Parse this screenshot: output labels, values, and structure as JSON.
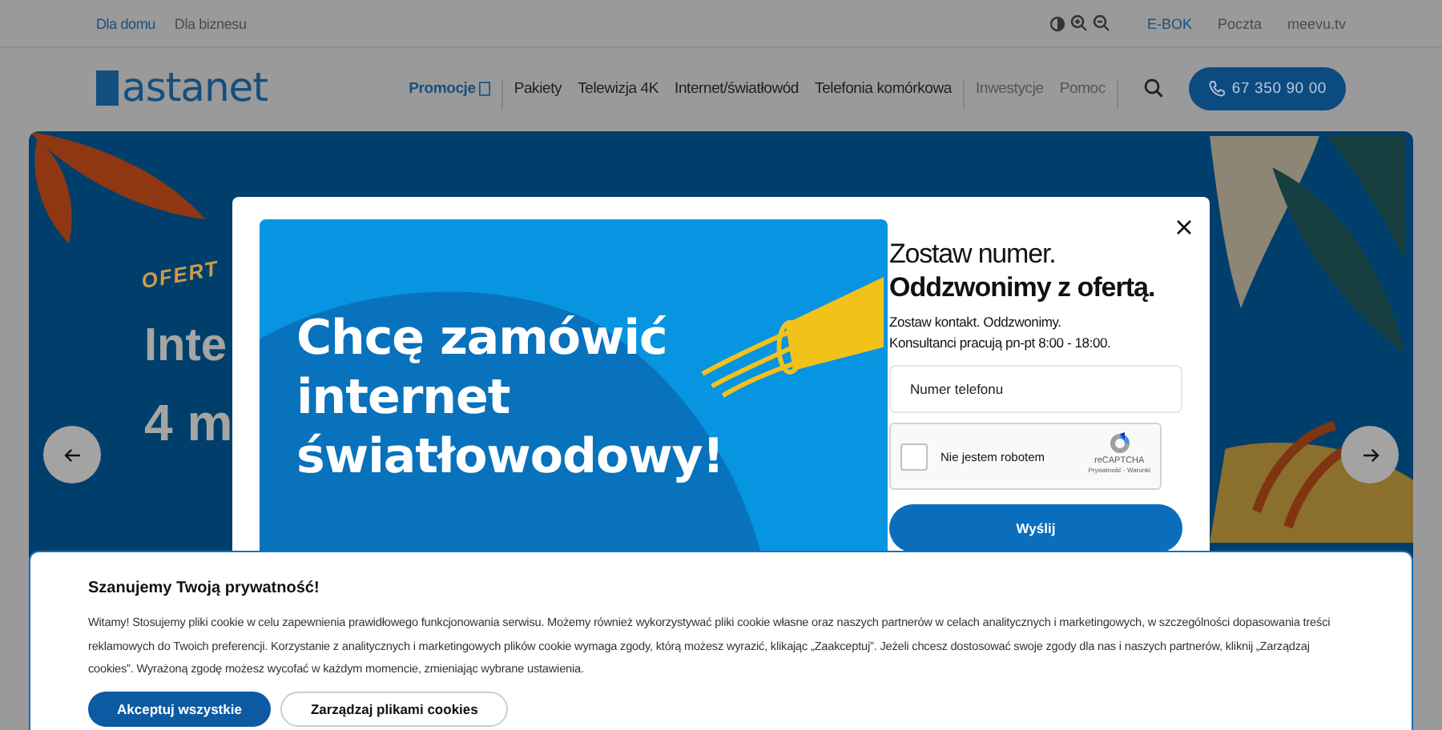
{
  "top_bar": {
    "segments": [
      {
        "label": "Dla domu",
        "selected": true
      },
      {
        "label": "Dla biznesu",
        "selected": false
      }
    ],
    "links": [
      {
        "label": "E-BOK",
        "kind": "accent"
      },
      {
        "label": "Poczta",
        "kind": "plain"
      },
      {
        "label": "meevu.tv",
        "kind": "plain"
      }
    ]
  },
  "header": {
    "logo": "astanet",
    "nav": [
      {
        "label": "Promocje",
        "kind": "promo"
      },
      {
        "label": "Pakiety",
        "kind": "main"
      },
      {
        "label": "Telewizja 4K",
        "kind": "main"
      },
      {
        "label": "Internet/światłowód",
        "kind": "main"
      },
      {
        "label": "Telefonia komórkowa",
        "kind": "main"
      },
      {
        "label": "Inwestycje",
        "kind": "secondary"
      },
      {
        "label": "Pomoc",
        "kind": "secondary"
      }
    ],
    "phone": "67 350 90 00"
  },
  "hero": {
    "tag": "OFERT",
    "title_lines": [
      "Inte",
      "4 m"
    ]
  },
  "modal": {
    "banner_lines": [
      "Chcę zamówić",
      "internet",
      "światłowodowy!"
    ],
    "heading": "Zostaw numer.",
    "heading_bold": "Oddzwonimy z ofertą.",
    "text_lines": [
      "Zostaw kontakt. Oddzwonimy.",
      "Konsultanci pracują pn-pt 8:00 - 18:00."
    ],
    "phone_placeholder": "Numer telefonu",
    "captcha": {
      "label": "Nie jestem robotem",
      "checked": false,
      "brand": "reCAPTCHA",
      "terms": "Prywatność - Warunki"
    },
    "submit": "Wyślij"
  },
  "cookie_banner": {
    "title": "Szanujemy Twoją prywatność!",
    "text": "Witamy! Stosujemy pliki cookie w celu zapewnienia prawidłowego funkcjonowania serwisu. Możemy również wykorzystywać pliki cookie własne oraz naszych partnerów w celach analitycznych i marketingowych, w szczególności dopasowania treści reklamowych do Twoich preferencji. Korzystanie z analitycznych i marketingowych plików cookie wymaga zgody, którą możesz wyrazić, klikając „Zaakceptuj”. Jeżeli chcesz dostosować swoje zgody dla nas i naszych partnerów, kliknij „Zarządzaj cookies”. Wyrażoną zgodę możesz wycofać w każdym momencie, zmieniając wybrane ustawienia.",
    "buttons": [
      {
        "label": "Akceptuj wszystkie",
        "kind": "primary"
      },
      {
        "label": "Zarządzaj plikami cookies",
        "kind": "outline"
      }
    ]
  }
}
